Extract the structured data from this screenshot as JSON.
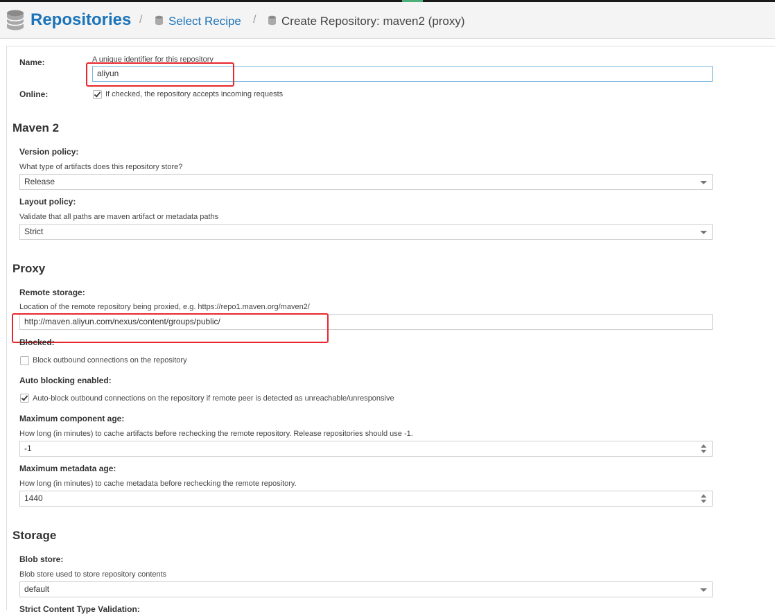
{
  "header": {
    "title": "Repositories",
    "separator": "/",
    "crumb_select_recipe": "Select Recipe",
    "crumb_create": "Create Repository: maven2 (proxy)"
  },
  "form": {
    "name": {
      "label": "Name:",
      "help": "A unique identifier for this repository",
      "value": "aliyun"
    },
    "online": {
      "label": "Online:",
      "help": "If checked, the repository accepts incoming requests",
      "checked": true
    },
    "maven2": {
      "heading": "Maven 2",
      "version_policy": {
        "label": "Version policy:",
        "help": "What type of artifacts does this repository store?",
        "value": "Release"
      },
      "layout_policy": {
        "label": "Layout policy:",
        "help": "Validate that all paths are maven artifact or metadata paths",
        "value": "Strict"
      }
    },
    "proxy": {
      "heading": "Proxy",
      "remote_storage": {
        "label": "Remote storage:",
        "help": "Location of the remote repository being proxied, e.g. https://repo1.maven.org/maven2/",
        "value": "http://maven.aliyun.com/nexus/content/groups/public/"
      },
      "blocked": {
        "label": "Blocked:",
        "help": "Block outbound connections on the repository",
        "checked": false
      },
      "auto_blocking": {
        "label": "Auto blocking enabled:",
        "help": "Auto-block outbound connections on the repository if remote peer is detected as unreachable/unresponsive",
        "checked": true
      },
      "max_component_age": {
        "label": "Maximum component age:",
        "help": "How long (in minutes) to cache artifacts before rechecking the remote repository. Release repositories should use -1.",
        "value": "-1"
      },
      "max_metadata_age": {
        "label": "Maximum metadata age:",
        "help": "How long (in minutes) to cache metadata before rechecking the remote repository.",
        "value": "1440"
      }
    },
    "storage": {
      "heading": "Storage",
      "blob_store": {
        "label": "Blob store:",
        "help": "Blob store used to store repository contents",
        "value": "default"
      },
      "strict_content": {
        "label": "Strict Content Type Validation:"
      }
    }
  },
  "colors": {
    "accent": "#1b73b9",
    "highlight": "#e8262b"
  }
}
